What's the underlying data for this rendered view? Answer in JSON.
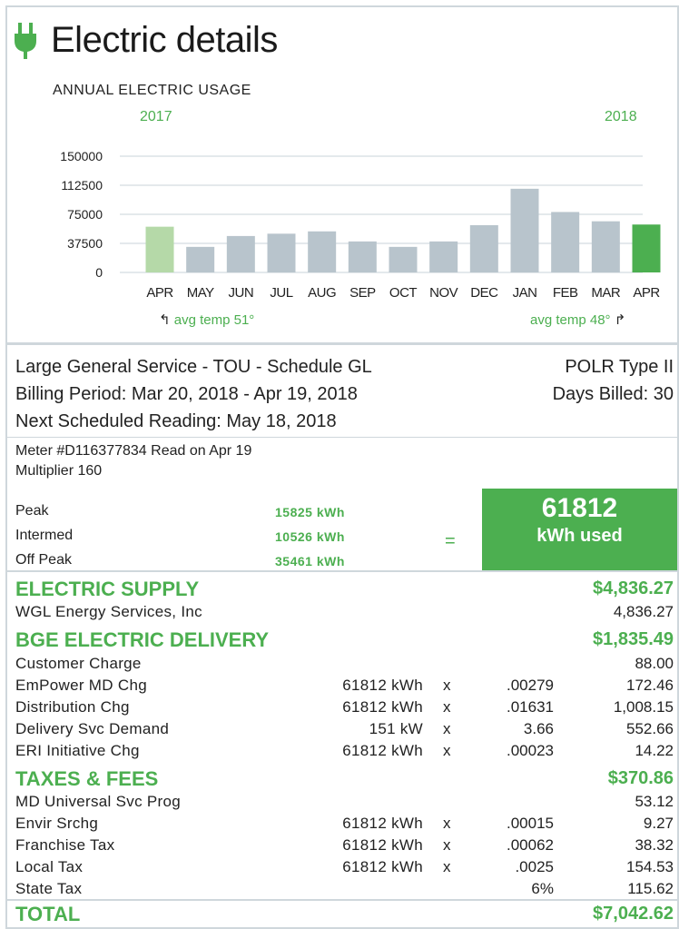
{
  "header": {
    "title": "Electric details",
    "plug_icon_color": "#4caf50"
  },
  "chart_data": {
    "type": "bar",
    "title": "ANNUAL ELECTRIC USAGE",
    "year_start": "2017",
    "year_end": "2018",
    "categories": [
      "APR",
      "MAY",
      "JUN",
      "JUL",
      "AUG",
      "SEP",
      "OCT",
      "NOV",
      "DEC",
      "JAN",
      "FEB",
      "MAR",
      "APR"
    ],
    "values": [
      59000,
      33000,
      47000,
      50000,
      53000,
      40000,
      33000,
      40000,
      61000,
      108000,
      78000,
      66000,
      61812
    ],
    "colors": [
      "#b5d9a8",
      "#b8c4cc",
      "#b8c4cc",
      "#b8c4cc",
      "#b8c4cc",
      "#b8c4cc",
      "#b8c4cc",
      "#b8c4cc",
      "#b8c4cc",
      "#b8c4cc",
      "#b8c4cc",
      "#b8c4cc",
      "#4caf50"
    ],
    "ytick_labels": [
      "150000",
      "112500",
      "75000",
      "37500",
      "0"
    ],
    "ytick_values": [
      150000,
      112500,
      75000,
      37500,
      0
    ],
    "ylim": [
      0,
      150000
    ],
    "grid": true,
    "temp_start": "avg temp 51°",
    "temp_end": "avg temp 48°"
  },
  "service": {
    "schedule": "Large General Service - TOU - Schedule GL",
    "type": "POLR Type II",
    "billing_period": "Billing Period: Mar 20, 2018 - Apr 19, 2018",
    "days_billed": "Days Billed: 30",
    "next_reading": "Next Scheduled Reading: May 18, 2018"
  },
  "meter": {
    "line1": "Meter #D116377834  Read on Apr 19",
    "line2": "Multiplier 160",
    "readings": [
      {
        "label": "Peak",
        "value": "15825 kWh"
      },
      {
        "label": "Intermed",
        "value": "10526 kWh"
      },
      {
        "label": "Off Peak",
        "value": "35461 kWh"
      }
    ],
    "equals": "=",
    "used_value": "61812",
    "used_label": "kWh used"
  },
  "supply": {
    "heading": "ELECTRIC SUPPLY",
    "amount": "$4,836.27",
    "lines": [
      {
        "label": "WGL Energy Services, Inc",
        "amount": "4,836.27"
      }
    ]
  },
  "delivery": {
    "heading": "BGE ELECTRIC DELIVERY",
    "amount": "$1,835.49",
    "lines": [
      {
        "label": "Customer Charge",
        "qty": "",
        "x": "",
        "rate": "",
        "amount": "88.00"
      },
      {
        "label": "EmPower MD Chg",
        "qty": "61812 kWh",
        "x": "x",
        "rate": ".00279",
        "amount": "172.46"
      },
      {
        "label": "Distribution Chg",
        "qty": "61812 kWh",
        "x": "x",
        "rate": ".01631",
        "amount": "1,008.15"
      },
      {
        "label": "Delivery Svc Demand",
        "qty": "151 kW",
        "x": "x",
        "rate": "3.66",
        "amount": "552.66"
      },
      {
        "label": "ERI Initiative Chg",
        "qty": "61812 kWh",
        "x": "x",
        "rate": ".00023",
        "amount": "14.22"
      }
    ]
  },
  "taxes": {
    "heading": "TAXES & FEES",
    "amount": "$370.86",
    "lines": [
      {
        "label": "MD Universal Svc Prog",
        "qty": "",
        "x": "",
        "rate": "",
        "amount": "53.12"
      },
      {
        "label": "Envir Srchg",
        "qty": "61812 kWh",
        "x": "x",
        "rate": ".00015",
        "amount": "9.27"
      },
      {
        "label": "Franchise Tax",
        "qty": "61812 kWh",
        "x": "x",
        "rate": ".00062",
        "amount": "38.32"
      },
      {
        "label": "Local Tax",
        "qty": "61812 kWh",
        "x": "x",
        "rate": ".0025",
        "amount": "154.53"
      },
      {
        "label": "State Tax",
        "qty": "",
        "x": "",
        "rate": "6%",
        "amount": "115.62"
      }
    ]
  },
  "total": {
    "label": "TOTAL",
    "amount": "$7,042.62"
  }
}
